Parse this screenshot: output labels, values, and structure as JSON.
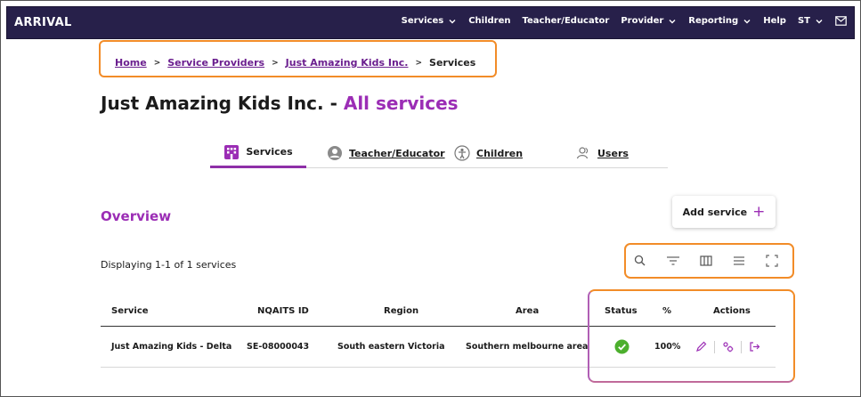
{
  "header": {
    "logo": "ARRIVAL",
    "nav": [
      {
        "label": "Services",
        "has_dropdown": true
      },
      {
        "label": "Children",
        "has_dropdown": false
      },
      {
        "label": "Teacher/Educator",
        "has_dropdown": false
      },
      {
        "label": "Provider",
        "has_dropdown": true
      },
      {
        "label": "Reporting",
        "has_dropdown": true
      },
      {
        "label": "Help",
        "has_dropdown": false
      },
      {
        "label": "ST",
        "has_dropdown": true
      }
    ],
    "mail_icon": "mail-icon"
  },
  "breadcrumb": {
    "items": [
      "Home",
      "Service Providers",
      "Just Amazing Kids Inc."
    ],
    "separator": ">",
    "current": "Services"
  },
  "page": {
    "title_main": "Just Amazing Kids Inc. - ",
    "title_accent": "All services"
  },
  "tabs": [
    {
      "label": "Services",
      "icon": "building-icon",
      "active": true
    },
    {
      "label": "Teacher/Educator",
      "icon": "person-circle-icon",
      "active": false
    },
    {
      "label": "Children",
      "icon": "child-icon",
      "active": false
    },
    {
      "label": "Users",
      "icon": "users-icon",
      "active": false
    }
  ],
  "overview": {
    "heading": "Overview",
    "add_button": "Add service",
    "add_icon": "+",
    "displaying": "Displaying 1-1 of 1 services",
    "toolbar_icons": [
      "search-icon",
      "filter-icon",
      "columns-icon",
      "density-icon",
      "fullscreen-icon"
    ]
  },
  "table": {
    "columns": [
      "Service",
      "NQAITS ID",
      "Region",
      "Area",
      "Status",
      "%",
      "Actions"
    ],
    "rows": [
      {
        "service": "Just Amazing Kids - Delta",
        "id": "SE-08000043",
        "region": "South eastern Victoria",
        "area": "Southern melbourne area",
        "status": "complete",
        "percent": "100%",
        "actions": [
          "edit-icon",
          "settings-icon",
          "exit-icon"
        ]
      }
    ]
  },
  "colors": {
    "nav_bg": "#27204a",
    "accent": "#9b2db5",
    "highlight": "#f28c28",
    "status_ok": "#4caf2d"
  }
}
